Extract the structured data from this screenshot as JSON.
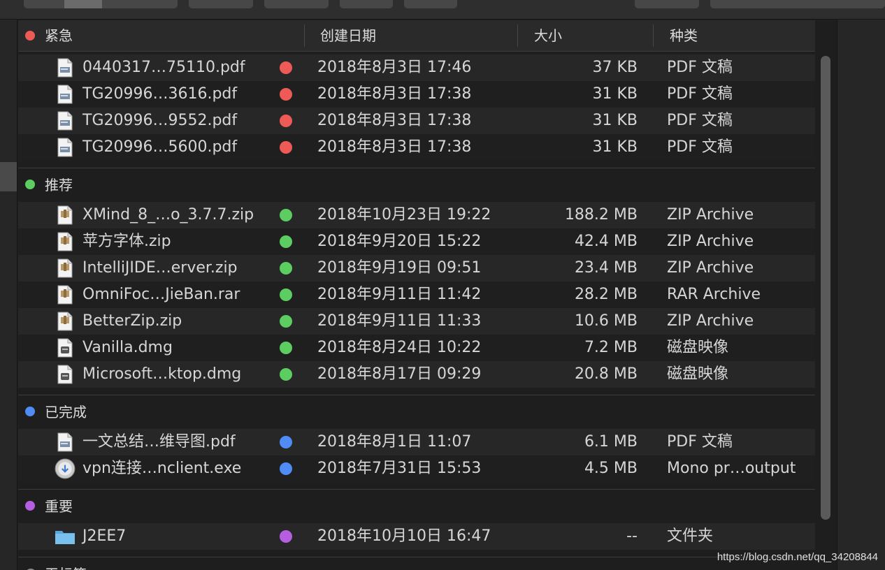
{
  "columns": {
    "name": "紧急",
    "date": "创建日期",
    "size": "大小",
    "kind": "种类"
  },
  "colors": {
    "red": "#ee5b56",
    "green": "#5ccd61",
    "blue": "#4f8df5",
    "purple": "#b55fe0",
    "gray": "#8a8a8a"
  },
  "groups": [
    {
      "label": "紧急",
      "color": "#ee5b56",
      "rows": [
        {
          "name": "0440317…75110.pdf",
          "icon": "pdf-file-icon",
          "date": "2018年8月3日 17:46",
          "size": "37 KB",
          "kind": "PDF 文稿"
        },
        {
          "name": "TG20996…3616.pdf",
          "icon": "pdf-file-icon",
          "date": "2018年8月3日 17:38",
          "size": "31 KB",
          "kind": "PDF 文稿"
        },
        {
          "name": "TG20996…9552.pdf",
          "icon": "pdf-file-icon",
          "date": "2018年8月3日 17:38",
          "size": "31 KB",
          "kind": "PDF 文稿"
        },
        {
          "name": "TG20996…5600.pdf",
          "icon": "pdf-file-icon",
          "date": "2018年8月3日 17:38",
          "size": "31 KB",
          "kind": "PDF 文稿"
        }
      ]
    },
    {
      "label": "推荐",
      "color": "#5ccd61",
      "rows": [
        {
          "name": "XMind_8_…o_3.7.7.zip",
          "icon": "zip-archive-icon",
          "date": "2018年10月23日 19:22",
          "size": "188.2 MB",
          "kind": "ZIP Archive"
        },
        {
          "name": "苹方字体.zip",
          "icon": "zip-archive-icon",
          "date": "2018年9月20日 15:22",
          "size": "42.4 MB",
          "kind": "ZIP Archive"
        },
        {
          "name": "IntelliJIDE…erver.zip",
          "icon": "zip-archive-icon",
          "date": "2018年9月19日 09:51",
          "size": "23.4 MB",
          "kind": "ZIP Archive"
        },
        {
          "name": "OmniFoc…JieBan.rar",
          "icon": "rar-archive-icon",
          "date": "2018年9月11日 11:42",
          "size": "28.2 MB",
          "kind": "RAR Archive"
        },
        {
          "name": "BetterZip.zip",
          "icon": "zip-archive-icon",
          "date": "2018年9月11日 11:33",
          "size": "10.6 MB",
          "kind": "ZIP Archive"
        },
        {
          "name": "Vanilla.dmg",
          "icon": "disk-image-icon",
          "date": "2018年8月24日 10:22",
          "size": "7.2 MB",
          "kind": "磁盘映像"
        },
        {
          "name": "Microsoft…ktop.dmg",
          "icon": "disk-image-icon",
          "date": "2018年8月17日 09:29",
          "size": "20.8 MB",
          "kind": "磁盘映像"
        }
      ]
    },
    {
      "label": "已完成",
      "color": "#4f8df5",
      "rows": [
        {
          "name": "一文总结…维导图.pdf",
          "icon": "pdf-file-icon",
          "date": "2018年8月1日 11:07",
          "size": "6.1 MB",
          "kind": "PDF 文稿"
        },
        {
          "name": "vpn连接…nclient.exe",
          "icon": "exe-installer-icon",
          "date": "2018年7月31日 15:53",
          "size": "4.5 MB",
          "kind": "Mono pr…output"
        }
      ]
    },
    {
      "label": "重要",
      "color": "#b55fe0",
      "rows": [
        {
          "name": "J2EE7",
          "icon": "folder-icon",
          "date": "2018年10月10日 16:47",
          "size": "--",
          "kind": "文件夹"
        }
      ]
    },
    {
      "label": "无标签",
      "color": "#8a8a8a",
      "rows": []
    }
  ],
  "watermark": "https://blog.csdn.net/qq_34208844"
}
